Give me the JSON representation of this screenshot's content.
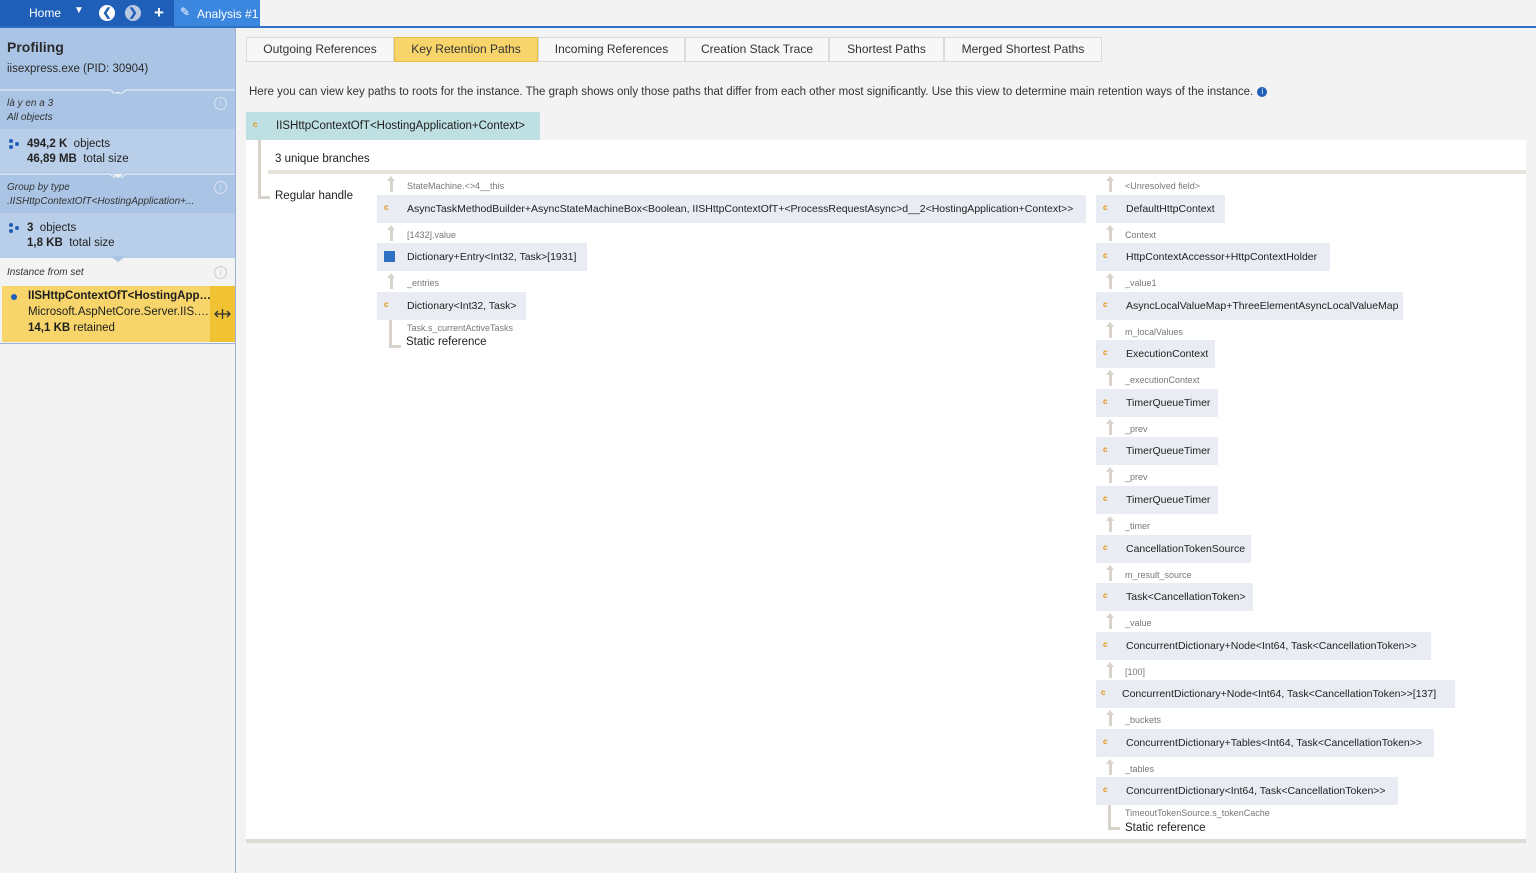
{
  "topbar": {
    "home_label": "Home",
    "home_menu_glyph": "▼",
    "back_glyph": "❮",
    "forward_glyph": "❯",
    "add_glyph": "+",
    "tab_label": "Analysis #1",
    "tab_icon": "✎"
  },
  "sidebar": {
    "profiling_title": "Profiling",
    "process": "iisexpress.exe (PID: 30904)",
    "set1_title": "là y en a 3",
    "set1_sub": "All objects",
    "set1_count": "494,2 K",
    "set1_count_unit": "objects",
    "set1_size": "46,89 MB",
    "set1_size_unit": "total size",
    "set2_title": "Group by type",
    "set2_sub": ".IISHttpContextOfT<HostingApplication+...",
    "set2_count": "3",
    "set2_count_unit": "objects",
    "set2_size": "1,8 KB",
    "set2_size_unit": "total size",
    "instance_header": "Instance from set",
    "instance_name": "IISHttpContextOfT<HostingAppli...",
    "instance_ns": "Microsoft.AspNetCore.Server.IIS.C...",
    "instance_retained": "14,1 KB",
    "instance_retained_unit": "retained",
    "info_glyph": "i"
  },
  "tabs": [
    {
      "label": "Outgoing References",
      "active": false
    },
    {
      "label": "Key Retention Paths",
      "active": true
    },
    {
      "label": "Incoming References",
      "active": false
    },
    {
      "label": "Creation Stack Trace",
      "active": false
    },
    {
      "label": "Shortest Paths",
      "active": false
    },
    {
      "label": "Merged Shortest Paths",
      "active": false
    }
  ],
  "description": "Here you can view key paths to roots for the instance. The graph shows only those paths that differ from each other most significantly. Use this view to determine main retention ways of the instance.",
  "info_glyph": "i",
  "root_node": "IISHttpContextOfT<HostingApplication+Context>",
  "branches_label": "3 unique branches",
  "regular_handle": "Regular handle",
  "left_path": {
    "fields": [
      "StateMachine.<>4__this",
      "[1432].value",
      "_entries",
      "Task.s_currentActiveTasks"
    ],
    "nodes": [
      "AsyncTaskMethodBuilder+AsyncStateMachineBox<Boolean, IISHttpContextOfT+<ProcessRequestAsync>d__2<HostingApplication+Context>>",
      "Dictionary+Entry<Int32, Task>[1931]",
      "Dictionary<Int32, Task>"
    ],
    "root": "Static reference"
  },
  "right_path": {
    "fields": [
      "<Unresolved field>",
      "Context",
      "_value1",
      "m_localValues",
      "_executionContext",
      "_prev",
      "_prev",
      "_timer",
      "m_result_source",
      "_value",
      "[100]",
      "_buckets",
      "_tables",
      "TimeoutTokenSource.s_tokenCache"
    ],
    "nodes": [
      "DefaultHttpContext",
      "HttpContextAccessor+HttpContextHolder",
      "AsyncLocalValueMap+ThreeElementAsyncLocalValueMap",
      "ExecutionContext",
      "TimerQueueTimer",
      "TimerQueueTimer",
      "TimerQueueTimer",
      "CancellationTokenSource",
      "Task<CancellationToken>",
      "ConcurrentDictionary+Node<Int64, Task<CancellationToken>>",
      "ConcurrentDictionary+Node<Int64, Task<CancellationToken>>[137]",
      "ConcurrentDictionary+Tables<Int64, Task<CancellationToken>>",
      "ConcurrentDictionary<Int64, Task<CancellationToken>>"
    ],
    "root": "Static reference"
  },
  "colors": {
    "accent": "#1f5fb8",
    "selected_tab": "#f7d56b",
    "sidebar_block": "#a9c4e4",
    "root_node_bg": "#bfe0e3",
    "class_icon": "#e0930f"
  },
  "icons": {
    "class_node": "class-icon",
    "array_node": "array-icon"
  }
}
